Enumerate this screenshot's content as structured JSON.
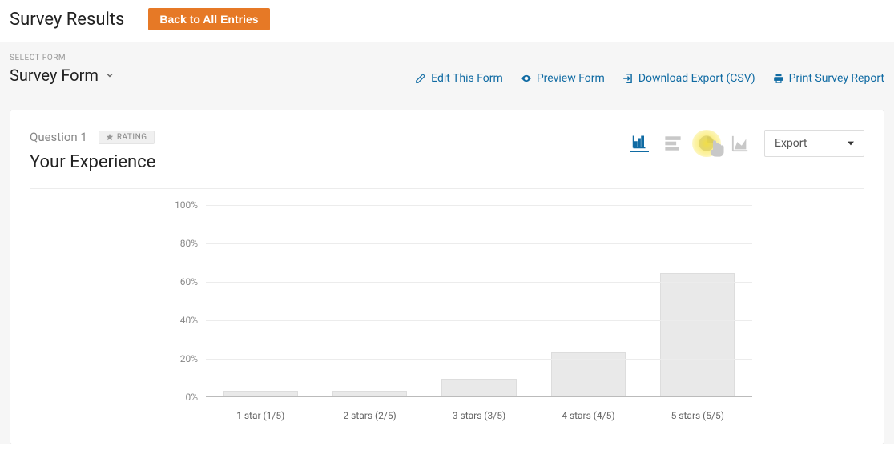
{
  "header": {
    "title": "Survey Results",
    "back_button": "Back to All Entries"
  },
  "form_selector": {
    "label": "SELECT FORM",
    "selected": "Survey Form"
  },
  "toolbar": {
    "edit": "Edit This Form",
    "preview": "Preview Form",
    "download": "Download Export (CSV)",
    "print": "Print Survey Report"
  },
  "question": {
    "number": "Question 1",
    "badge": "RATING",
    "title": "Your Experience",
    "export_label": "Export"
  },
  "chart_data": {
    "type": "bar",
    "categories": [
      "1 star (1/5)",
      "2 stars (2/5)",
      "3 stars (3/5)",
      "4 stars (4/5)",
      "5 stars (5/5)"
    ],
    "values": [
      3,
      3,
      9,
      23,
      64
    ],
    "ylabel": "",
    "xlabel": "",
    "ylim": [
      0,
      100
    ],
    "yticks": [
      "0%",
      "20%",
      "40%",
      "60%",
      "80%",
      "100%"
    ]
  }
}
